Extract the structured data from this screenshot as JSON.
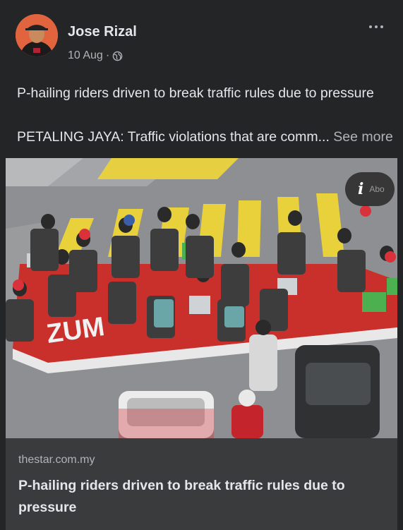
{
  "post": {
    "author": "Jose Rizal",
    "date": "10 Aug",
    "separator": "·",
    "privacy_icon": "globe-icon",
    "menu_icon": "more-horizontal-icon",
    "title_line": "P-hailing riders driven to break traffic rules due to pressure",
    "excerpt": "PETALING JAYA: Traffic violations that are comm...",
    "see_more": "See more"
  },
  "photo": {
    "info_icon": "info-icon",
    "info_glyph": "i",
    "info_label": "Abo",
    "road_marking": "ZUM"
  },
  "link_preview": {
    "domain": "thestar.com.my",
    "title": "P-hailing riders driven to break traffic rules due to pressure"
  },
  "colors": {
    "background": "#242526",
    "link_box": "#3a3b3c",
    "text_primary": "#e4e6eb",
    "text_secondary": "#b0b3b8",
    "road_red": "#c9302c",
    "crossing_yellow": "#e8d13a"
  }
}
